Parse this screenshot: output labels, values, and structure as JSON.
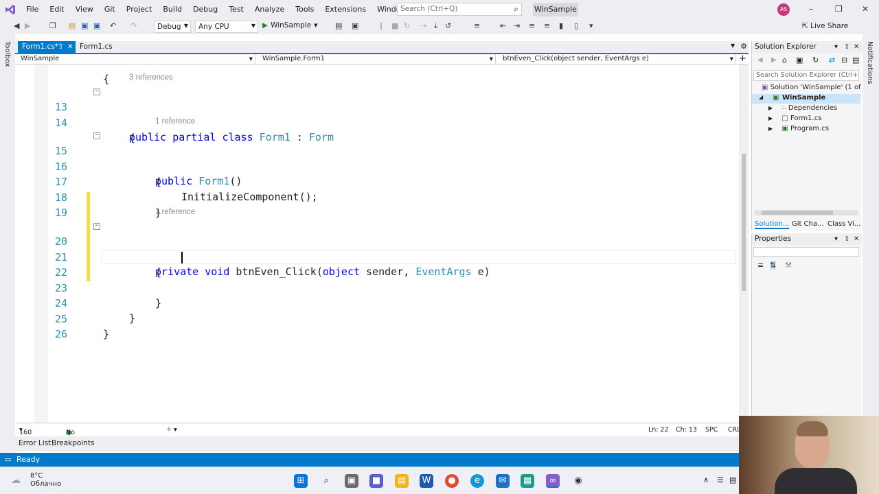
{
  "menubar": {
    "items": [
      "File",
      "Edit",
      "View",
      "Git",
      "Project",
      "Build",
      "Debug",
      "Test",
      "Analyze",
      "Tools",
      "Extensions",
      "Window",
      "Help"
    ],
    "search_placeholder": "Search (Ctrl+Q)",
    "solution_name": "WinSample",
    "avatar_initials": "AS"
  },
  "toolbar": {
    "configuration": "Debug",
    "platform": "Any CPU",
    "run_target": "WinSample",
    "live_share": "Live Share"
  },
  "toolbox_label": "Toolbox",
  "notifications_label": "Notifications",
  "doc_tabs": [
    {
      "label": "Form1.cs*",
      "active": true
    },
    {
      "label": "Form1.cs [Design]*",
      "active": false
    }
  ],
  "navbar": {
    "project": "WinSample",
    "type": "WinSample.Form1",
    "member": "btnEven_Click(object sender, EventArgs e)"
  },
  "code": {
    "line12_partial": "{",
    "lines": [
      {
        "n": "13",
        "refs": "3 references"
      },
      {
        "n": "14"
      },
      {
        "n": "15",
        "refs": "1 reference"
      },
      {
        "n": "16"
      },
      {
        "n": "17"
      },
      {
        "n": "18"
      },
      {
        "n": "19"
      },
      {
        "n": "20",
        "refs": "1 reference"
      },
      {
        "n": "21"
      },
      {
        "n": "22"
      },
      {
        "n": "23"
      },
      {
        "n": "24"
      },
      {
        "n": "25"
      },
      {
        "n": "26"
      }
    ],
    "l13": {
      "kw": "public partial class",
      "name": "Form1",
      "colon": " : ",
      "base": "Form"
    },
    "brace_open": "{",
    "brace_close": "}",
    "l15": {
      "kw": "public",
      "name": "Form1",
      "rest": "()"
    },
    "l17": "InitializeComponent();",
    "l20": {
      "kw": "private void",
      "method": "btnEven_Click",
      "p1": "(",
      "k1": "object",
      "p2": " sender, ",
      "t2": "EventArgs",
      "p3": " e)"
    }
  },
  "editor_status": {
    "zoom": "160 %",
    "issues": "No issues found",
    "ln": "Ln: 22",
    "ch": "Ch: 13",
    "mode": "SPC",
    "eol": "CRL"
  },
  "bottom_tabs": [
    "Error List",
    "Breakpoints"
  ],
  "status": "Ready",
  "solution_explorer": {
    "title": "Solution Explorer",
    "search_placeholder": "Search Solution Explorer (Ctrl+;)",
    "solution": "Solution 'WinSample' (1 of 1",
    "project": "WinSample",
    "items": [
      "Dependencies",
      "Form1.cs",
      "Program.cs"
    ],
    "tabs": [
      "Solution...",
      "Git Cha...",
      "Class Vi..."
    ]
  },
  "properties": {
    "title": "Properties"
  },
  "weather": {
    "temp": "8°C",
    "desc": "Облачно"
  },
  "colors": {
    "accent": "#007acc",
    "keyword": "#0000ff",
    "type": "#2b91af"
  }
}
